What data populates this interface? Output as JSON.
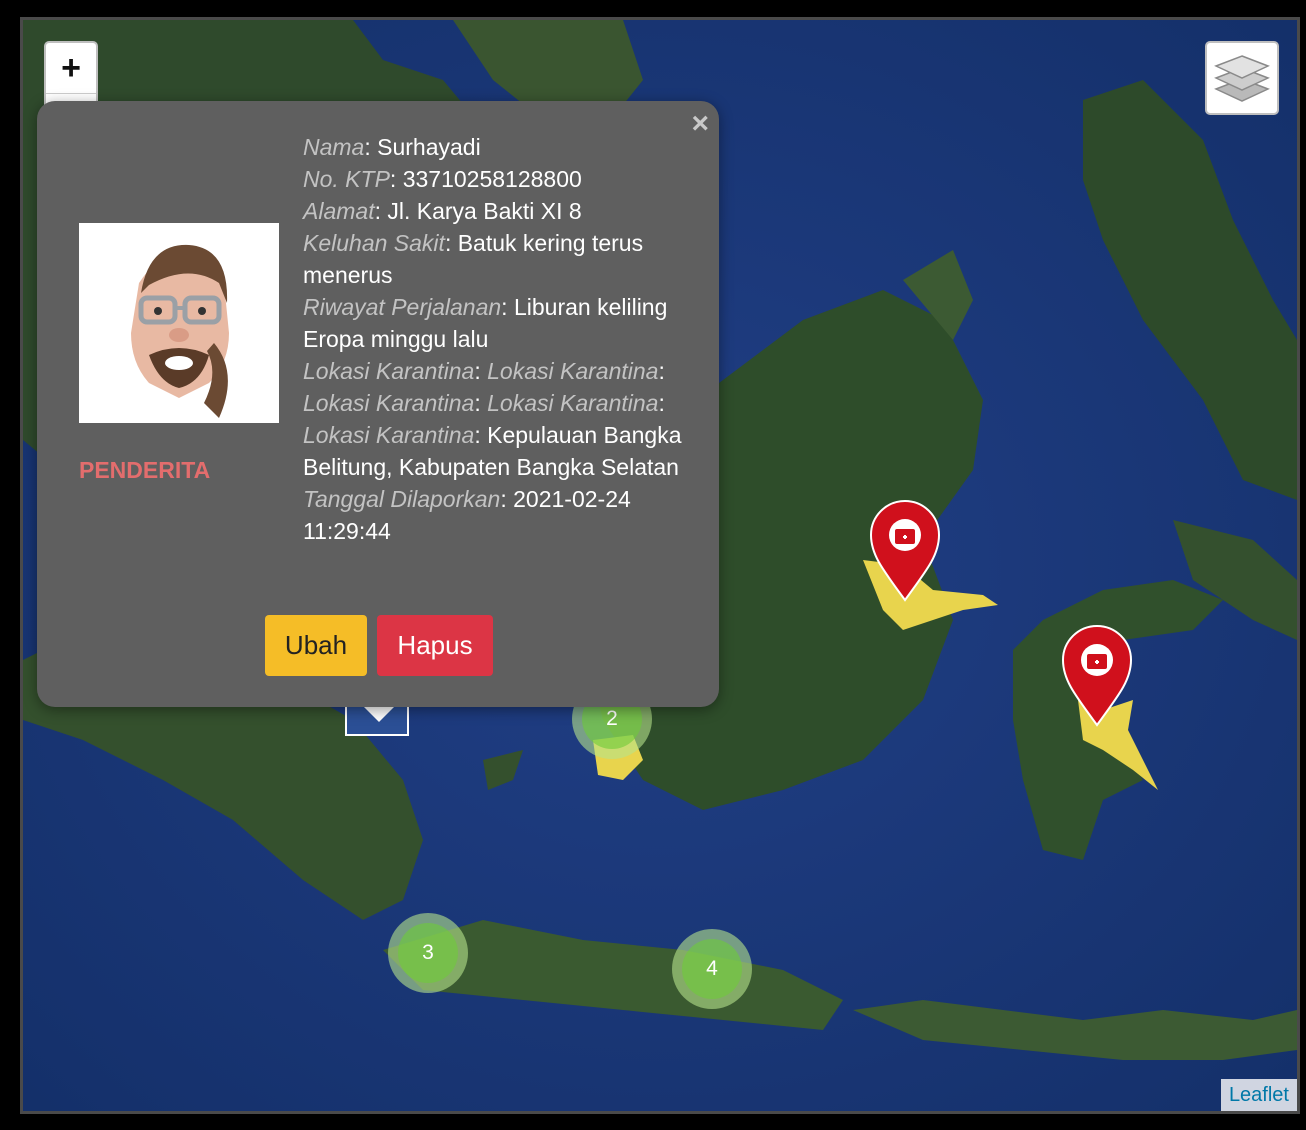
{
  "map": {
    "controls": {
      "zoom_in": "+",
      "zoom_out": "−"
    },
    "attribution": "Leaflet",
    "clusters": [
      {
        "count": "2"
      },
      {
        "count": "3"
      },
      {
        "count": "4"
      }
    ],
    "colors": {
      "marker": "#d0101c",
      "region_fill": "#e8d44d",
      "cluster_inner": "#6ecc39",
      "cluster_outer": "#b5e28c"
    }
  },
  "popup": {
    "close": "×",
    "status": "PENDERITA",
    "fields": [
      {
        "label": "Nama",
        "value": "Surhayadi"
      },
      {
        "label": "No. KTP",
        "value": "33710258128800"
      },
      {
        "label": "Alamat",
        "value": "Jl. Karya Bakti XI 8"
      },
      {
        "label": "Keluhan Sakit",
        "value": "Batuk kering terus menerus"
      },
      {
        "label": "Riwayat Perjalanan",
        "value": "Liburan keliling Eropa minggu lalu"
      }
    ],
    "location": {
      "label_1": "Lokasi Karantina",
      "label_2": "Lokasi Karantina",
      "label_3": "Lokasi Karantina",
      "label_4": "Lokasi Karantina",
      "label_5": "Lokasi Karantina",
      "value": "Kepulauan Bangka Belitung, Kabupaten Bangka Selatan"
    },
    "reported": {
      "label": "Tanggal Dilaporkan",
      "value": "2021-02-24 11:29:44"
    },
    "buttons": {
      "edit": "Ubah",
      "delete": "Hapus"
    },
    "colors": {
      "status": "#e36d6d",
      "edit": "#f5bd27",
      "delete": "#dc3545"
    }
  }
}
